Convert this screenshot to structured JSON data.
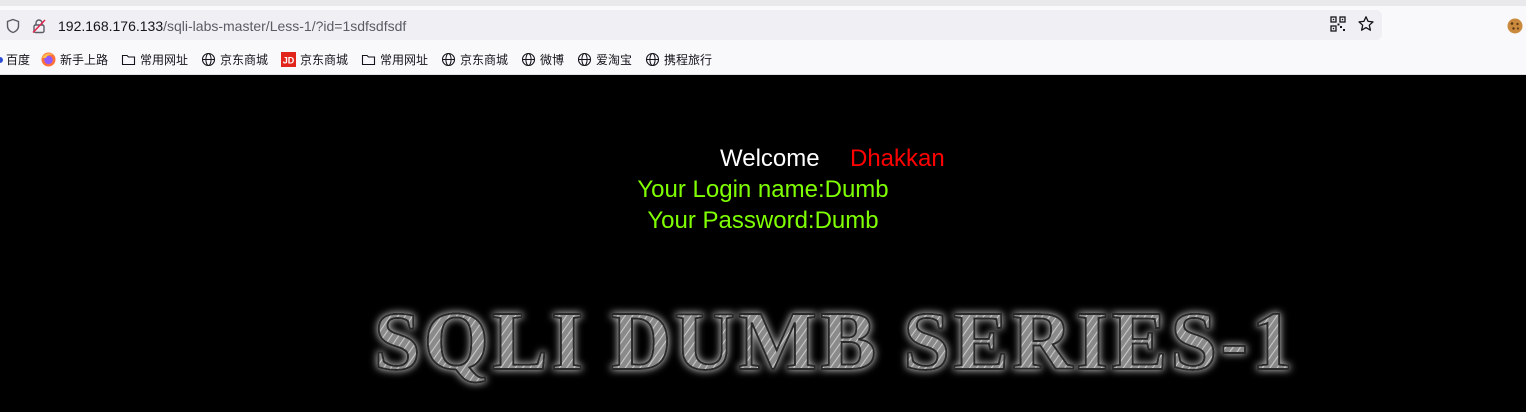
{
  "browser": {
    "url_host": "192.168.176.133",
    "url_path": "/sqli-labs-master/Less-1/?id=1sdfsdfsdf"
  },
  "bookmarks": [
    {
      "label": "百度",
      "icon": "paw-icon"
    },
    {
      "label": "新手上路",
      "icon": "firefox-icon"
    },
    {
      "label": "常用网址",
      "icon": "folder-icon"
    },
    {
      "label": "京东商城",
      "icon": "globe-icon"
    },
    {
      "label": "京东商城",
      "icon": "jd-icon"
    },
    {
      "label": "常用网址",
      "icon": "folder-icon"
    },
    {
      "label": "京东商城",
      "icon": "globe-icon"
    },
    {
      "label": "微博",
      "icon": "globe-icon"
    },
    {
      "label": "爱淘宝",
      "icon": "globe-icon"
    },
    {
      "label": "携程旅行",
      "icon": "globe-icon"
    }
  ],
  "page": {
    "welcome": "Welcome",
    "user": "Dhakkan",
    "login_line": "Your Login name:Dumb",
    "password_line": "Your Password:Dumb",
    "banner": "SQLI DUMB SERIES-1"
  },
  "colors": {
    "background": "#000000",
    "welcome": "#ffffff",
    "user": "#ff0000",
    "result": "#7fff00"
  }
}
